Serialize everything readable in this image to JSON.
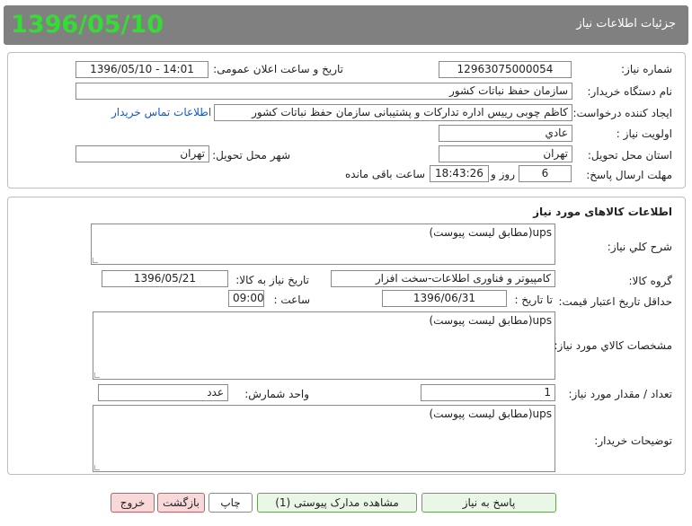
{
  "header": {
    "date": "1396/05/10",
    "title": "جزئیات اطلاعات نیاز"
  },
  "details": {
    "need_number_label": "شماره نیاز:",
    "need_number": "1296307500005‎4",
    "announce_label": "تاریخ و ساعت اعلان عمومی:",
    "announce_value": "1396/05/10 - 14:01",
    "buyer_org_label": "نام دستگاه خریدار:",
    "buyer_org": "سازمان حفظ نباتات کشور",
    "creator_label": "ایجاد کننده درخواست:",
    "creator": "کاظم چوبی رییس اداره تدارکات و پشتیبانی سازمان حفظ نباتات کشور",
    "contact_link": "اطلاعات تماس خریدار",
    "priority_label": "اولویت نیاز :",
    "priority": "عادي",
    "province_label": "استان محل تحویل:",
    "province": "تهران",
    "city_label": "شهر محل تحویل:",
    "city": "تهران",
    "deadline_label": "مهلت ارسال پاسخ:",
    "days": "6",
    "days_suffix": "روز و",
    "time": "18:43:26",
    "time_suffix": "ساعت باقی مانده"
  },
  "goods": {
    "section_title": "اطلاعات کالاهای مورد نیاز",
    "summary_label": "شرح کلي نياز:",
    "summary": "ups(مطابق لیست پیوست)",
    "group_label": "گروه کالا:",
    "group": "کامپیوتر و فناوری اطلاعات-سخت افزار",
    "need_date_label": "تاریخ نیاز به کالا:",
    "need_date": "1396/05/21",
    "validity_label": "حداقل تاریخ اعتبار قیمت:",
    "until_date_label": "تا تاریخ :",
    "until_date": "1396/06/31",
    "time_label": "ساعت :",
    "time": "09:00",
    "specs_label": "مشخصات کالاي مورد نياز:",
    "specs": "ups(مطابق لیست پیوست)",
    "qty_label": "تعداد / مقدار مورد نیاز:",
    "qty": "1",
    "unit_label": "واحد شمارش:",
    "unit": "عدد",
    "notes_label": "توضیحات خریدار:",
    "notes": "ups(مطابق لیست پیوست)"
  },
  "footer": {
    "respond": "پاسخ به نیاز",
    "attachments": "مشاهده مدارک پیوستی (1)",
    "print": "چاپ",
    "back": "بازگشت",
    "exit": "خروج"
  },
  "colors": {
    "header_bg": "#7f7f7f",
    "date_text": "#2bd62b",
    "link": "#1a56c8"
  }
}
